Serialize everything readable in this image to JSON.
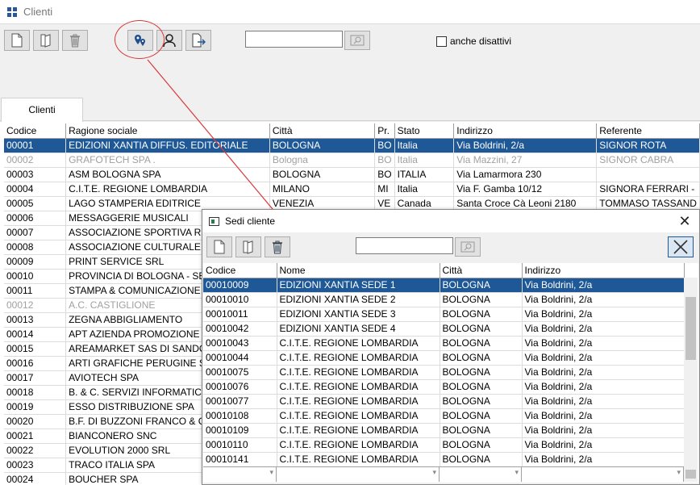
{
  "window": {
    "title": "Clienti"
  },
  "toolbar": {
    "search_value": "",
    "show_inactive_label": "anche disattivi"
  },
  "tabs": [
    {
      "label": "Clienti"
    }
  ],
  "clienti": {
    "columns": [
      "Codice",
      "Ragione sociale",
      "Città",
      "Pr.",
      "Stato",
      "Indirizzo",
      "Referente"
    ],
    "rows": [
      {
        "codice": "00001",
        "ragione": "EDIZIONI XANTIA DIFFUS. EDITORIALE",
        "citta": "BOLOGNA",
        "pr": "BO",
        "stato": "Italia",
        "indirizzo": "Via Boldrini, 2/a",
        "referente": "SIGNOR ROTA",
        "selected": true
      },
      {
        "codice": "00002",
        "ragione": "GRAFOTECH SPA .",
        "citta": "Bologna",
        "pr": "BO",
        "stato": "Italia",
        "indirizzo": "Via Mazzini, 27",
        "referente": "SIGNOR CABRA",
        "disabled": true
      },
      {
        "codice": "00003",
        "ragione": "ASM BOLOGNA SPA",
        "citta": "BOLOGNA",
        "pr": "BO",
        "stato": "ITALIA",
        "indirizzo": "Via Lamarmora 230",
        "referente": ""
      },
      {
        "codice": "00004",
        "ragione": "C.I.T.E. REGIONE LOMBARDIA",
        "citta": "MILANO",
        "pr": "MI",
        "stato": "Italia",
        "indirizzo": "Via F. Gamba 10/12",
        "referente": "SIGNORA FERRARI -"
      },
      {
        "codice": "00005",
        "ragione": "LAGO STAMPERIA EDITRICE",
        "citta": "VENEZIA",
        "pr": "VE",
        "stato": "Canada",
        "indirizzo": "Santa Croce Cà Leoni 2180",
        "referente": "TOMMASO TASSAND"
      },
      {
        "codice": "00006",
        "ragione": "MESSAGGERIE MUSICALI",
        "citta": "",
        "pr": "",
        "stato": "",
        "indirizzo": "",
        "referente": ""
      },
      {
        "codice": "00007",
        "ragione": "ASSOCIAZIONE SPORTIVA REN",
        "citta": "",
        "pr": "",
        "stato": "",
        "indirizzo": "",
        "referente": ""
      },
      {
        "codice": "00008",
        "ragione": "ASSOCIAZIONE CULTURALE GA",
        "citta": "",
        "pr": "",
        "stato": "",
        "indirizzo": "",
        "referente": ""
      },
      {
        "codice": "00009",
        "ragione": "PRINT SERVICE SRL",
        "citta": "",
        "pr": "",
        "stato": "",
        "indirizzo": "",
        "referente": ""
      },
      {
        "codice": "00010",
        "ragione": "PROVINCIA DI BOLOGNA - SETT",
        "citta": "",
        "pr": "",
        "stato": "",
        "indirizzo": "",
        "referente": ""
      },
      {
        "codice": "00011",
        "ragione": "STAMPA & COMUNICAZIONE SR",
        "citta": "",
        "pr": "",
        "stato": "",
        "indirizzo": "",
        "referente": ""
      },
      {
        "codice": "00012",
        "ragione": "A.C. CASTIGLIONE",
        "citta": "",
        "pr": "",
        "stato": "",
        "indirizzo": "",
        "referente": "",
        "disabled": true
      },
      {
        "codice": "00013",
        "ragione": "ZEGNA ABBIGLIAMENTO",
        "citta": "",
        "pr": "",
        "stato": "",
        "indirizzo": "",
        "referente": ""
      },
      {
        "codice": "00014",
        "ragione": "APT AZIENDA PROMOZIONE TU",
        "citta": "",
        "pr": "",
        "stato": "",
        "indirizzo": "",
        "referente": ""
      },
      {
        "codice": "00015",
        "ragione": "AREAMARKET SAS DI SANDON",
        "citta": "",
        "pr": "",
        "stato": "",
        "indirizzo": "",
        "referente": ""
      },
      {
        "codice": "00016",
        "ragione": "ARTI GRAFICHE PERUGINE SN",
        "citta": "",
        "pr": "",
        "stato": "",
        "indirizzo": "",
        "referente": ""
      },
      {
        "codice": "00017",
        "ragione": "AVIOTECH SPA",
        "citta": "",
        "pr": "",
        "stato": "",
        "indirizzo": "",
        "referente": ""
      },
      {
        "codice": "00018",
        "ragione": "B. & C. SERVIZI INFORMATICI S",
        "citta": "",
        "pr": "",
        "stato": "",
        "indirizzo": "",
        "referente": ""
      },
      {
        "codice": "00019",
        "ragione": "ESSO DISTRIBUZIONE   SPA",
        "citta": "",
        "pr": "",
        "stato": "",
        "indirizzo": "",
        "referente": ""
      },
      {
        "codice": "00020",
        "ragione": "B.F. DI BUZZONI FRANCO & C. S",
        "citta": "",
        "pr": "",
        "stato": "",
        "indirizzo": "",
        "referente": ""
      },
      {
        "codice": "00021",
        "ragione": "BIANCONERO SNC",
        "citta": "",
        "pr": "",
        "stato": "",
        "indirizzo": "",
        "referente": ""
      },
      {
        "codice": "00022",
        "ragione": "EVOLUTION 2000 SRL",
        "citta": "",
        "pr": "",
        "stato": "",
        "indirizzo": "",
        "referente": ""
      },
      {
        "codice": "00023",
        "ragione": "TRACO ITALIA SPA",
        "citta": "",
        "pr": "",
        "stato": "",
        "indirizzo": "",
        "referente": ""
      },
      {
        "codice": "00024",
        "ragione": "BOUCHER  SPA",
        "citta": "",
        "pr": "",
        "stato": "",
        "indirizzo": "",
        "referente": ""
      }
    ]
  },
  "dialog": {
    "title": "Sedi cliente",
    "search_value": "",
    "columns": [
      "Codice",
      "Nome",
      "Città",
      "Indirizzo"
    ],
    "rows": [
      {
        "codice": "00010009",
        "nome": "EDIZIONI XANTIA SEDE 1",
        "citta": "BOLOGNA",
        "indirizzo": "Via Boldrini, 2/a",
        "selected": true
      },
      {
        "codice": "00010010",
        "nome": "EDIZIONI XANTIA SEDE 2",
        "citta": "BOLOGNA",
        "indirizzo": "Via Boldrini, 2/a"
      },
      {
        "codice": "00010011",
        "nome": "EDIZIONI XANTIA SEDE 3",
        "citta": "BOLOGNA",
        "indirizzo": "Via Boldrini, 2/a"
      },
      {
        "codice": "00010042",
        "nome": "EDIZIONI XANTIA SEDE 4",
        "citta": "BOLOGNA",
        "indirizzo": "Via Boldrini, 2/a"
      },
      {
        "codice": "00010043",
        "nome": "C.I.T.E. REGIONE LOMBARDIA",
        "citta": "BOLOGNA",
        "indirizzo": "Via Boldrini, 2/a"
      },
      {
        "codice": "00010044",
        "nome": "C.I.T.E. REGIONE LOMBARDIA",
        "citta": "BOLOGNA",
        "indirizzo": "Via Boldrini, 2/a"
      },
      {
        "codice": "00010075",
        "nome": "C.I.T.E. REGIONE LOMBARDIA",
        "citta": "BOLOGNA",
        "indirizzo": "Via Boldrini, 2/a"
      },
      {
        "codice": "00010076",
        "nome": "C.I.T.E. REGIONE LOMBARDIA",
        "citta": "BOLOGNA",
        "indirizzo": "Via Boldrini, 2/a"
      },
      {
        "codice": "00010077",
        "nome": "C.I.T.E. REGIONE LOMBARDIA",
        "citta": "BOLOGNA",
        "indirizzo": "Via Boldrini, 2/a"
      },
      {
        "codice": "00010108",
        "nome": "C.I.T.E. REGIONE LOMBARDIA",
        "citta": "BOLOGNA",
        "indirizzo": "Via Boldrini, 2/a"
      },
      {
        "codice": "00010109",
        "nome": "C.I.T.E. REGIONE LOMBARDIA",
        "citta": "BOLOGNA",
        "indirizzo": "Via Boldrini, 2/a"
      },
      {
        "codice": "00010110",
        "nome": "C.I.T.E. REGIONE LOMBARDIA",
        "citta": "BOLOGNA",
        "indirizzo": "Via Boldrini, 2/a"
      },
      {
        "codice": "00010141",
        "nome": "C.I.T.E. REGIONE LOMBARDIA",
        "citta": "BOLOGNA",
        "indirizzo": "Via Boldrini, 2/a"
      }
    ]
  },
  "colors": {
    "selection": "#1f5896",
    "annotation": "#d9393b"
  }
}
